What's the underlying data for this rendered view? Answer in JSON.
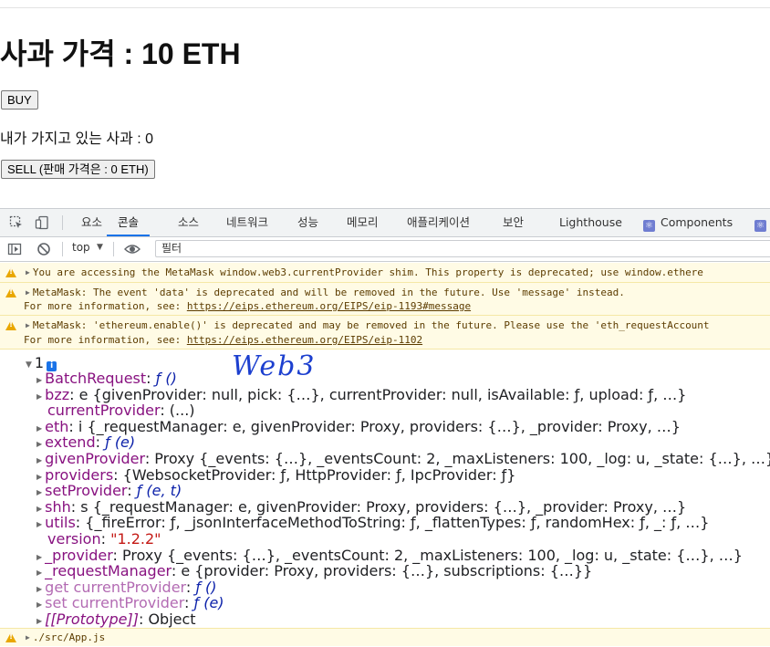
{
  "page": {
    "title": "사과 가격 : 10 ETH",
    "buy_label": "BUY",
    "owned_text": "내가 가지고 있는 사과 : 0",
    "sell_label": "SELL (판매 가격은 : 0 ETH)"
  },
  "devtools": {
    "tabs": [
      "요소",
      "콘솔",
      "소스",
      "네트워크",
      "성능",
      "메모리",
      "애플리케이션",
      "보안",
      "Lighthouse",
      "Components"
    ],
    "active_tab": "콘솔",
    "context": "top",
    "filter_placeholder": "필터"
  },
  "console": {
    "warnings": [
      {
        "text": "You are accessing the MetaMask window.web3.currentProvider shim. This property is deprecated; use window.ethere"
      },
      {
        "text": "MetaMask: The event 'data' is deprecated and will be removed in the future. Use 'message' instead.",
        "more": "For more information, see: ",
        "link": "https://eips.ethereum.org/EIPS/eip-1193#message"
      },
      {
        "text": "MetaMask: 'ethereum.enable()' is deprecated and may be removed in the future. Please use the 'eth_requestAccount",
        "more": "For more information, see: ",
        "link": "https://eips.ethereum.org/EIPS/eip-1102"
      }
    ],
    "object_count": "1",
    "annotation": "Web3",
    "props": [
      {
        "key": "BatchRequest",
        "sep": ": ",
        "val": "ƒ ()"
      },
      {
        "key": "bzz",
        "sep": ": ",
        "val": "e {givenProvider: null, pick: {…}, currentProvider: null, isAvailable: ƒ, upload: ƒ, …}"
      },
      {
        "key": "currentProvider",
        "sep": ": ",
        "val": "(...)"
      },
      {
        "key": "eth",
        "sep": ": ",
        "val": "i {_requestManager: e, givenProvider: Proxy, providers: {…}, _provider: Proxy, …}"
      },
      {
        "key": "extend",
        "sep": ": ",
        "val": "ƒ (e)"
      },
      {
        "key": "givenProvider",
        "sep": ": ",
        "val": "Proxy {_events: {…}, _eventsCount: 2, _maxListeners: 100, _log: u, _state: {…}, …}"
      },
      {
        "key": "providers",
        "sep": ": ",
        "val": "{WebsocketProvider: ƒ, HttpProvider: ƒ, IpcProvider: ƒ}"
      },
      {
        "key": "setProvider",
        "sep": ": ",
        "val": "ƒ (e, t)"
      },
      {
        "key": "shh",
        "sep": ": ",
        "val": "s {_requestManager: e, givenProvider: Proxy, providers: {…}, _provider: Proxy, …}"
      },
      {
        "key": "utils",
        "sep": ": ",
        "val": "{_fireError: ƒ, _jsonInterfaceMethodToString: ƒ, _flattenTypes: ƒ, randomHex: ƒ, _: ƒ, …}"
      },
      {
        "key": "version",
        "sep": ": ",
        "val": "\"1.2.2\""
      },
      {
        "key": "_provider",
        "sep": ": ",
        "val": "Proxy {_events: {…}, _eventsCount: 2, _maxListeners: 100, _log: u, _state: {…}, …}"
      },
      {
        "key": "_requestManager",
        "sep": ": ",
        "val": "e {provider: Proxy, providers: {…}, subscriptions: {…}}"
      },
      {
        "key": "get currentProvider",
        "sep": ": ",
        "val": "ƒ ()"
      },
      {
        "key": "set currentProvider",
        "sep": ": ",
        "val": "ƒ (e)"
      },
      {
        "key": "[[Prototype]]",
        "sep": ": ",
        "val": "Object"
      }
    ],
    "source_warning": "./src/App.js"
  },
  "colors": {
    "accent": "#1a73e8",
    "warning_bg": "#fffbe5",
    "warning_icon": "#e9a700"
  }
}
